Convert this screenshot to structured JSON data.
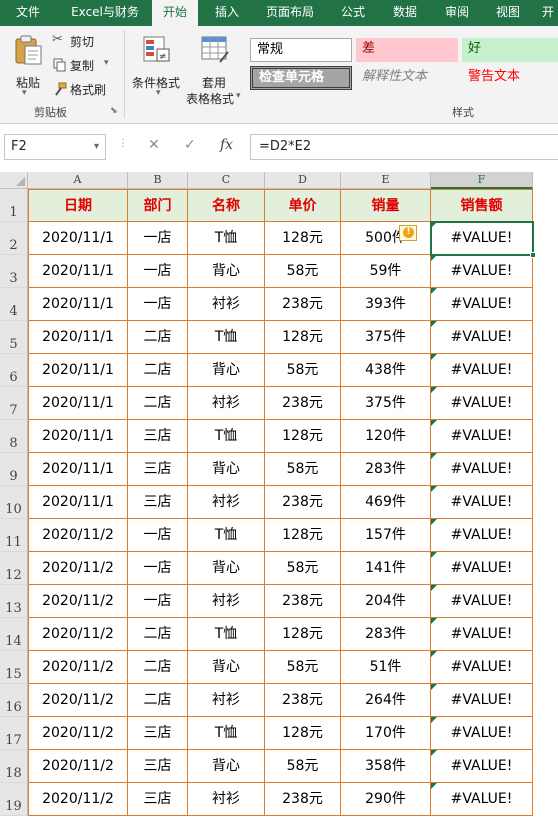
{
  "menu": {
    "tabs": [
      "文件",
      "Excel与财务",
      "开始",
      "插入",
      "页面布局",
      "公式",
      "数据",
      "审阅",
      "视图",
      "开"
    ]
  },
  "ribbon": {
    "paste_label": "粘贴",
    "cut_label": "剪切",
    "copy_label": "复制",
    "format_painter_label": "格式刷",
    "clipboard_group": "剪贴板",
    "conditional_format_label": "条件格式",
    "table_format_label_1": "套用",
    "table_format_label_2": "表格格式",
    "styles_group": "样式",
    "styles": {
      "normal": "常规",
      "bad": "差",
      "good": "好",
      "check_cell": "检查单元格",
      "explanatory": "解释性文本",
      "warning": "警告文本"
    }
  },
  "formula_bar": {
    "name_box": "F2",
    "formula": "=D2*E2"
  },
  "columns": [
    "A",
    "B",
    "C",
    "D",
    "E",
    "F"
  ],
  "selected_column": "F",
  "selected_cell": "F2",
  "headers": [
    "日期",
    "部门",
    "名称",
    "单价",
    "销量",
    "销售额"
  ],
  "rows": [
    [
      "2020/11/1",
      "一店",
      "T恤",
      "128元",
      "500件",
      "#VALUE!"
    ],
    [
      "2020/11/1",
      "一店",
      "背心",
      "58元",
      "59件",
      "#VALUE!"
    ],
    [
      "2020/11/1",
      "一店",
      "衬衫",
      "238元",
      "393件",
      "#VALUE!"
    ],
    [
      "2020/11/1",
      "二店",
      "T恤",
      "128元",
      "375件",
      "#VALUE!"
    ],
    [
      "2020/11/1",
      "二店",
      "背心",
      "58元",
      "438件",
      "#VALUE!"
    ],
    [
      "2020/11/1",
      "二店",
      "衬衫",
      "238元",
      "375件",
      "#VALUE!"
    ],
    [
      "2020/11/1",
      "三店",
      "T恤",
      "128元",
      "120件",
      "#VALUE!"
    ],
    [
      "2020/11/1",
      "三店",
      "背心",
      "58元",
      "283件",
      "#VALUE!"
    ],
    [
      "2020/11/1",
      "三店",
      "衬衫",
      "238元",
      "469件",
      "#VALUE!"
    ],
    [
      "2020/11/2",
      "一店",
      "T恤",
      "128元",
      "157件",
      "#VALUE!"
    ],
    [
      "2020/11/2",
      "一店",
      "背心",
      "58元",
      "141件",
      "#VALUE!"
    ],
    [
      "2020/11/2",
      "一店",
      "衬衫",
      "238元",
      "204件",
      "#VALUE!"
    ],
    [
      "2020/11/2",
      "二店",
      "T恤",
      "128元",
      "283件",
      "#VALUE!"
    ],
    [
      "2020/11/2",
      "二店",
      "背心",
      "58元",
      "51件",
      "#VALUE!"
    ],
    [
      "2020/11/2",
      "二店",
      "衬衫",
      "238元",
      "264件",
      "#VALUE!"
    ],
    [
      "2020/11/2",
      "三店",
      "T恤",
      "128元",
      "170件",
      "#VALUE!"
    ],
    [
      "2020/11/2",
      "三店",
      "背心",
      "58元",
      "358件",
      "#VALUE!"
    ],
    [
      "2020/11/2",
      "三店",
      "衬衫",
      "238元",
      "290件",
      "#VALUE!"
    ]
  ],
  "colors": {
    "excel_green": "#217346",
    "border_orange": "#e07a2e",
    "header_fill": "#e2efda",
    "header_text": "#e00000",
    "error_triangle": "#107c41"
  },
  "icons": {
    "cut": "scissors-icon",
    "copy": "copy-icon",
    "format_painter": "brush-icon",
    "error_indicator": "warning-icon"
  }
}
